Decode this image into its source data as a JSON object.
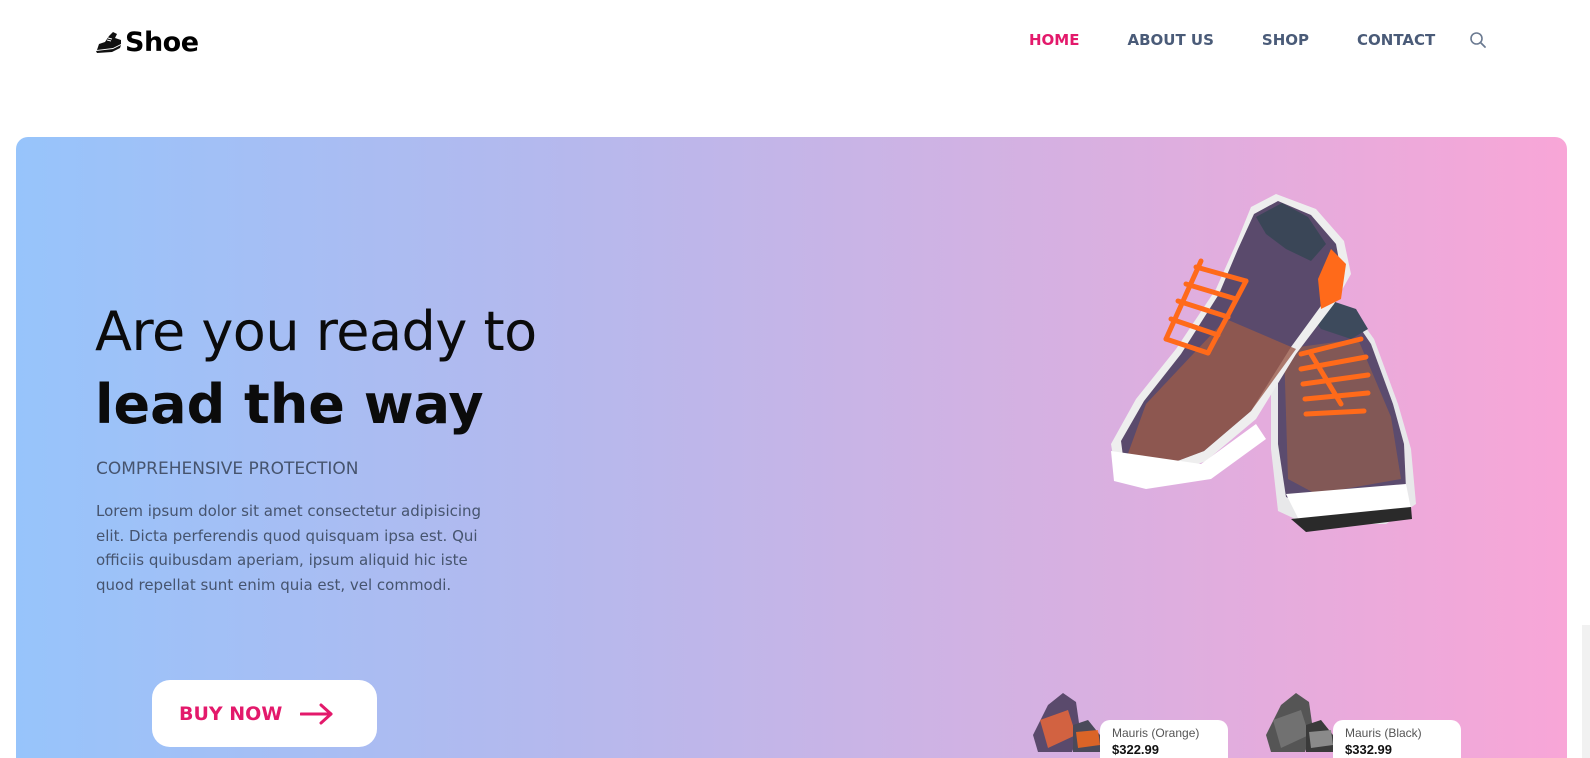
{
  "header": {
    "logo_text": "Shoe",
    "nav": [
      {
        "label": "HOME",
        "active": true
      },
      {
        "label": "ABOUT US",
        "active": false
      },
      {
        "label": "SHOP",
        "active": false
      },
      {
        "label": "CONTACT",
        "active": false
      }
    ],
    "search_icon": "search-icon"
  },
  "hero": {
    "title_line1": "Are you ready to",
    "title_line2": "lead the way",
    "subtitle": "COMPREHENSIVE PROTECTION",
    "description": "Lorem ipsum dolor sit amet consectetur adipisicing elit. Dicta perferendis quod quisquam ipsa est. Qui officiis quibusdam aperiam, ipsum aliquid hic iste quod repellat sunt enim quia est, vel commodi.",
    "cta_label": "BUY NOW",
    "cta_icon": "arrow-right-icon"
  },
  "products": [
    {
      "name": "Mauris (Orange)",
      "price": "$322.99"
    },
    {
      "name": "Mauris (Black)",
      "price": "$332.99"
    }
  ],
  "colors": {
    "accent": "#e3196b",
    "nav_text": "#4a5b78",
    "gradient_start": "#97c4fb",
    "gradient_end": "#f8a6d7"
  }
}
